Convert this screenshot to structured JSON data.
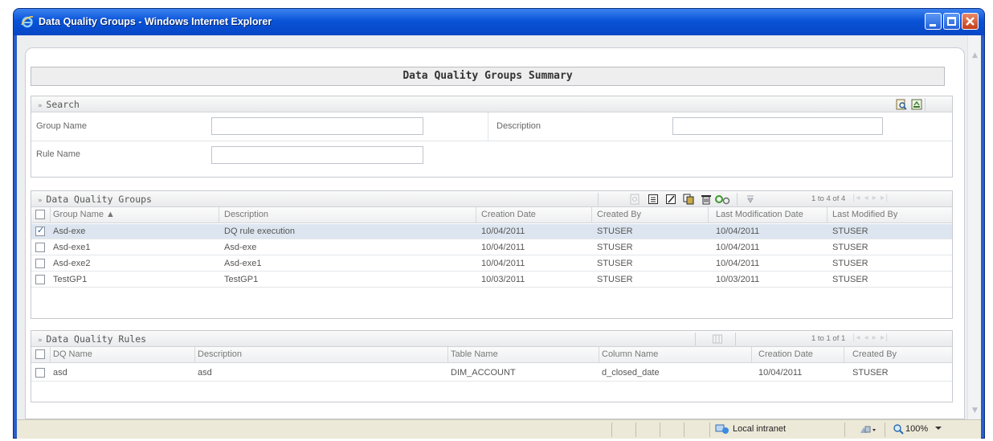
{
  "window": {
    "title": "Data Quality Groups - Windows Internet Explorer"
  },
  "page": {
    "title": "Data Quality Groups Summary"
  },
  "search": {
    "section_title": "Search",
    "fields": {
      "group_name": {
        "label": "Group Name",
        "value": ""
      },
      "description": {
        "label": "Description",
        "value": ""
      },
      "rule_name": {
        "label": "Rule Name",
        "value": ""
      }
    }
  },
  "groups": {
    "section_title": "Data Quality Groups",
    "pager": "1 to 4 of 4",
    "columns": [
      "Group Name ▲",
      "Description",
      "Creation Date",
      "Created By",
      "Last Modification Date",
      "Last Modified By"
    ],
    "rows": [
      {
        "checked": true,
        "cells": [
          "Asd-exe",
          "DQ rule execution",
          "10/04/2011",
          "STUSER",
          "10/04/2011",
          "STUSER"
        ]
      },
      {
        "checked": false,
        "cells": [
          "Asd-exe1",
          "Asd-exe",
          "10/04/2011",
          "STUSER",
          "10/04/2011",
          "STUSER"
        ]
      },
      {
        "checked": false,
        "cells": [
          "Asd-exe2",
          "Asd-exe1",
          "10/04/2011",
          "STUSER",
          "10/04/2011",
          "STUSER"
        ]
      },
      {
        "checked": false,
        "cells": [
          "TestGP1",
          "TestGP1",
          "10/03/2011",
          "STUSER",
          "10/03/2011",
          "STUSER"
        ]
      }
    ]
  },
  "rules": {
    "section_title": "Data Quality Rules",
    "pager": "1 to 1 of 1",
    "columns": [
      "DQ Name",
      "Description",
      "Table Name",
      "Column Name",
      "Creation Date",
      "Created By"
    ],
    "rows": [
      {
        "checked": false,
        "cells": [
          "asd",
          "asd",
          "DIM_ACCOUNT",
          "d_closed_date",
          "10/04/2011",
          "STUSER"
        ]
      }
    ]
  },
  "statusbar": {
    "zone": "Local intranet",
    "zoom": "100%"
  },
  "colors": {
    "titlebar": "#0a53d8",
    "selected_row": "#dde6f0",
    "statusbar": "#ece9d8"
  }
}
